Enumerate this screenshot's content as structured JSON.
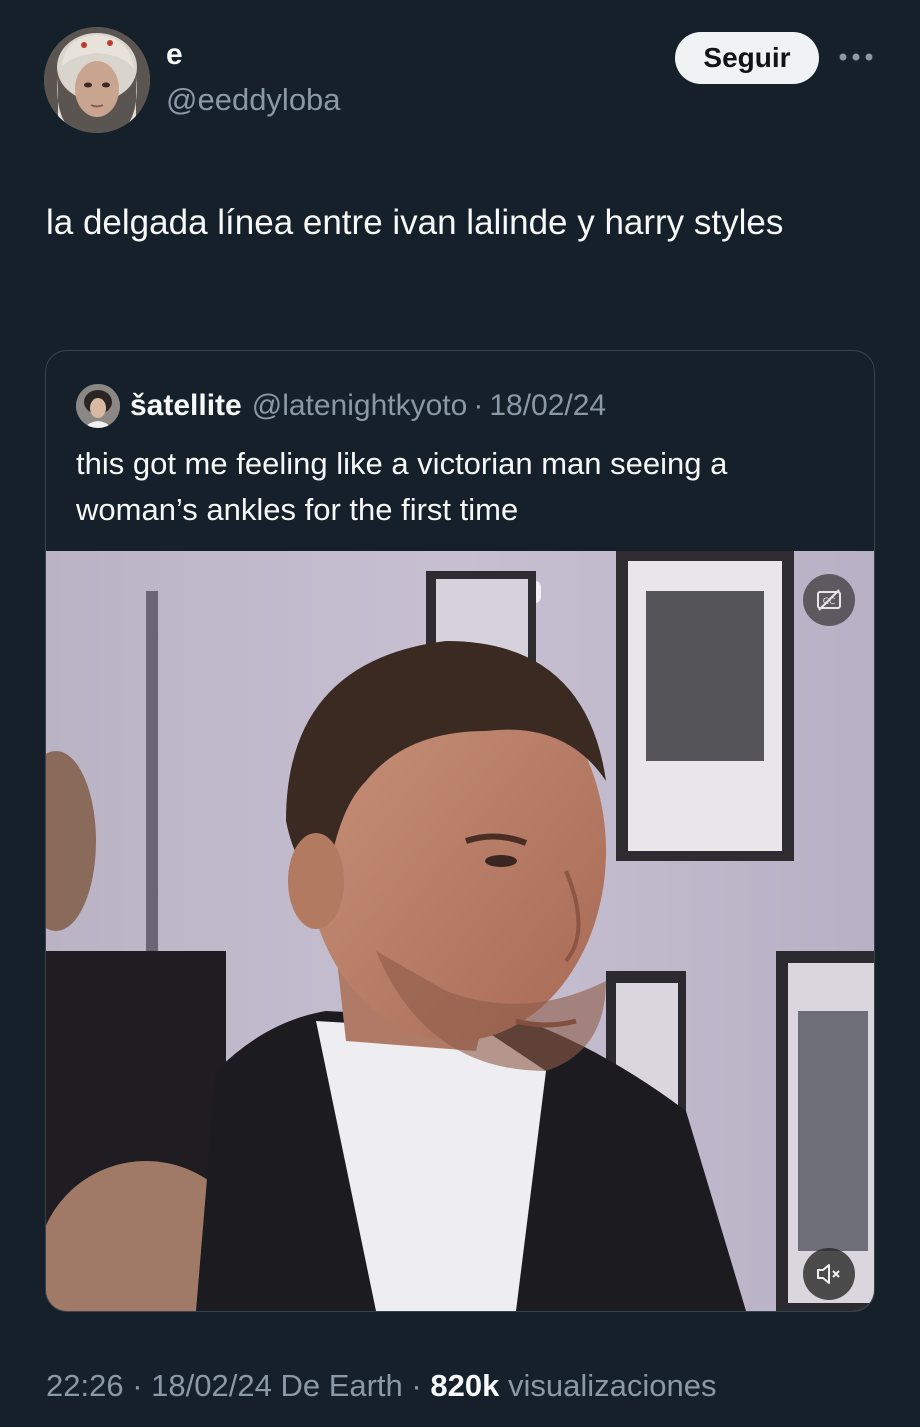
{
  "author": {
    "display_name": "e",
    "handle": "@eeddyloba",
    "follow_label": "Seguir"
  },
  "tweet": {
    "text": "la delgada línea entre ivan lalinde y harry styles"
  },
  "quoted": {
    "display_name": "šatellite",
    "handle": "@latenightkyoto",
    "separator": "·",
    "date": "18/02/24",
    "text": "this got me feeling like a victorian man seeing a woman’s ankles for the first time"
  },
  "media": {
    "type": "video",
    "cc_icon": "closed-captions-off-icon",
    "mute_icon": "speaker-muted-icon"
  },
  "meta": {
    "time": "22:26",
    "sep1": "·",
    "date": "18/02/24",
    "source": "De Earth",
    "sep2": "·",
    "views_count": "820k",
    "views_label": "visualizaciones"
  },
  "colors": {
    "background": "#15202b",
    "text_primary": "#f7f9f9",
    "text_secondary": "#8b98a5",
    "border": "#38444d",
    "follow_button_bg": "#eff3f4"
  }
}
